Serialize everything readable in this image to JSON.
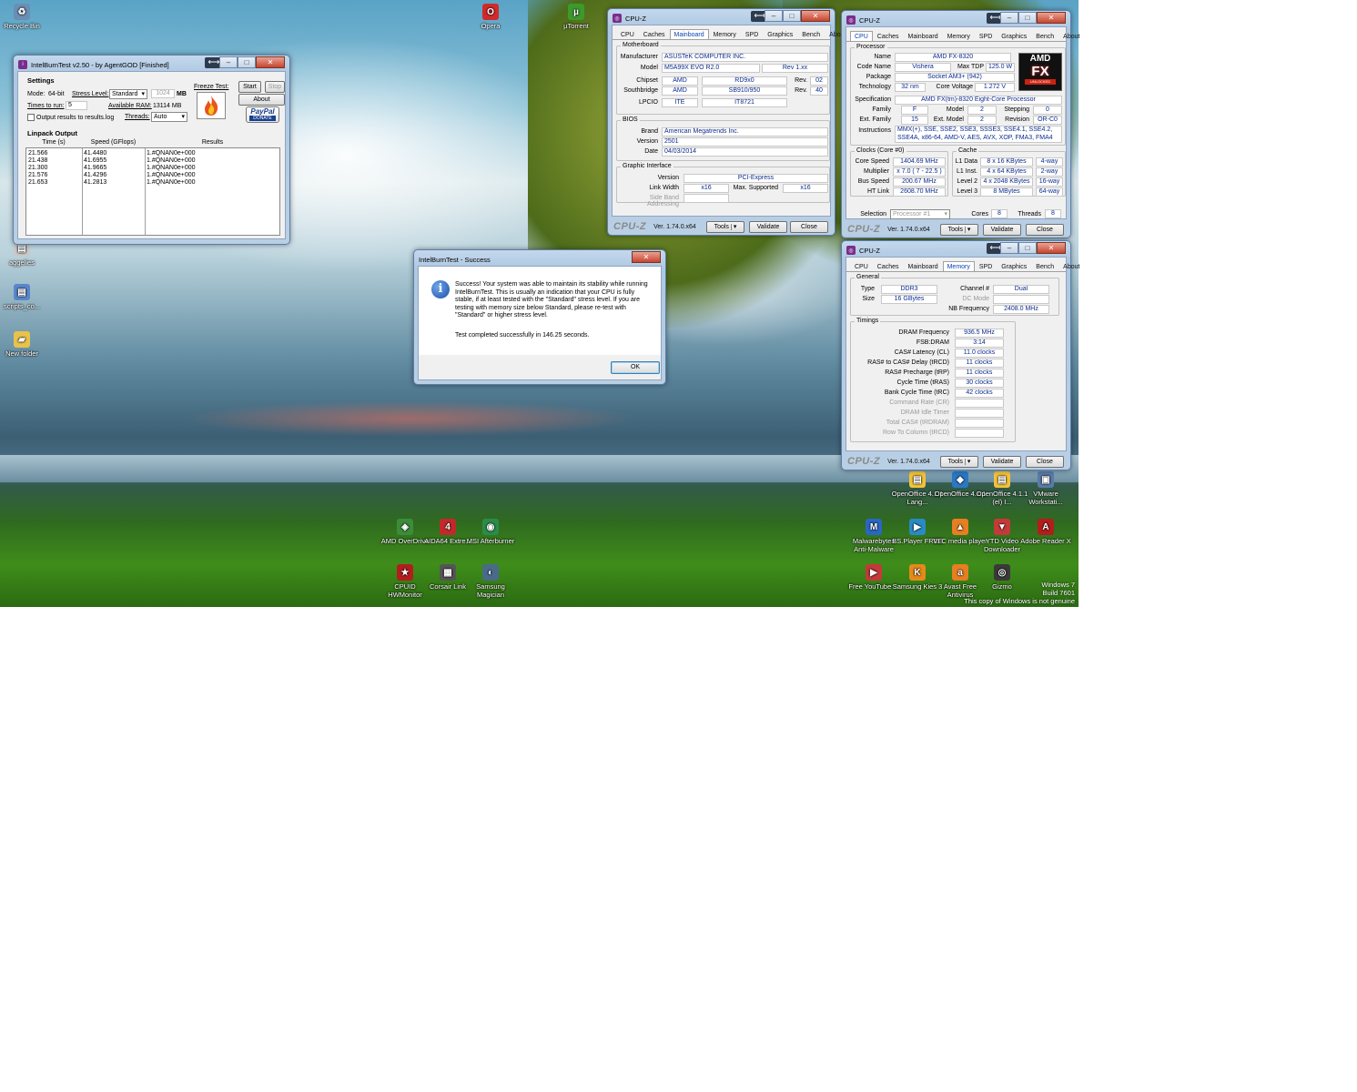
{
  "desktop": {
    "icons": [
      {
        "label": "Recycle Bin",
        "color": "#6a8fb5",
        "glyph": "♻"
      },
      {
        "label": "Opera",
        "color": "#d12a2a",
        "glyph": "O"
      },
      {
        "label": "µTorrent",
        "color": "#3c9a2a",
        "glyph": "µ"
      },
      {
        "label": "aggelies",
        "color": "#c9c9c9",
        "glyph": "▤"
      },
      {
        "label": "scripts_co...",
        "color": "#5a86c9",
        "glyph": "▤"
      },
      {
        "label": "New folder",
        "color": "#e8c24c",
        "glyph": "▰"
      },
      {
        "label": "OpenOffice 4.1.1 Lang...",
        "color": "#f2c23a",
        "glyph": "▤"
      },
      {
        "label": "OpenOffice 4.1.1",
        "color": "#2a78c4",
        "glyph": "◆"
      },
      {
        "label": "OpenOffice 4.1.1 (el) I...",
        "color": "#f2c23a",
        "glyph": "▤"
      },
      {
        "label": "VMware Workstati...",
        "color": "#5a7aa8",
        "glyph": "▣"
      },
      {
        "label": "AMD OverDrive",
        "color": "#3c8c3c",
        "glyph": "◈"
      },
      {
        "label": "AIDA64 Extre...",
        "color": "#c22a2a",
        "glyph": "4"
      },
      {
        "label": "MSI Afterburner",
        "color": "#2a8c4a",
        "glyph": "◉"
      },
      {
        "label": "Malwarebytes Anti-Malware",
        "color": "#2a66c4",
        "glyph": "M"
      },
      {
        "label": "BS.Player FREE",
        "color": "#2a8ac4",
        "glyph": "▶"
      },
      {
        "label": "VLC media player",
        "color": "#e67e22",
        "glyph": "▲"
      },
      {
        "label": "YTD Video Downloader",
        "color": "#c43a3a",
        "glyph": "▼"
      },
      {
        "label": "Adobe Reader X",
        "color": "#b31d1d",
        "glyph": "A"
      },
      {
        "label": "CPUID HWMonitor",
        "color": "#b31d1d",
        "glyph": "★"
      },
      {
        "label": "Corsair Link",
        "color": "#555555",
        "glyph": "▦"
      },
      {
        "label": "Samsung Magician",
        "color": "#4a6a8a",
        "glyph": "◐"
      },
      {
        "label": "Free YouTube ...",
        "color": "#c43a3a",
        "glyph": "▶"
      },
      {
        "label": "Samsung Kies 3",
        "color": "#e58a1a",
        "glyph": "K"
      },
      {
        "label": "Avast Free Antivirus",
        "color": "#e67e22",
        "glyph": "a"
      },
      {
        "label": "Gizmo",
        "color": "#3a3a3a",
        "glyph": "◎"
      }
    ],
    "watermark": [
      "Windows 7",
      "Build 7601",
      "This copy of Windows is not genuine"
    ]
  },
  "ibt": {
    "title": "IntelBurnTest v2.50 - by AgentGOD [Finished]",
    "settings": "Settings",
    "mode_label": "Mode:",
    "mode_value": "64-bit",
    "stress_label": "Stress Level:",
    "stress_value": "Standard",
    "mem_value": "1024",
    "mem_unit": "MB",
    "times_label": "Times to run:",
    "times_value": "5",
    "avail_label": "Available RAM:",
    "avail_value": "13114 MB",
    "output_label": "Output results to results.log",
    "threads_label": "Threads:",
    "threads_value": "Auto",
    "freeze_label": "Freeze Test:",
    "start": "Start",
    "stop": "Stop",
    "about": "About",
    "paypal": "PayPal",
    "donate": "DONATE",
    "linpack": "Linpack Output",
    "col_time": "Time (s)",
    "col_speed": "Speed (GFlops)",
    "col_results": "Results",
    "rows": [
      {
        "time": "21.566",
        "speed": "41.4480",
        "result": "1.#QNAN0e+000"
      },
      {
        "time": "21.438",
        "speed": "41.6955",
        "result": "1.#QNAN0e+000"
      },
      {
        "time": "21.300",
        "speed": "41.9665",
        "result": "1.#QNAN0e+000"
      },
      {
        "time": "21.576",
        "speed": "41.4296",
        "result": "1.#QNAN0e+000"
      },
      {
        "time": "21.653",
        "speed": "41.2813",
        "result": "1.#QNAN0e+000"
      }
    ]
  },
  "dialog": {
    "title": "IntelBurnTest - Success",
    "message": "Success! Your system was able to maintain its stability while running IntelBurnTest. This is usually an indication that your CPU is fully stable, if at least tested with the \"Standard\" stress level. If you are testing with memory size below Standard, please re-test with \"Standard\" or higher stress level.",
    "completed": "Test completed successfully in 146.25 seconds.",
    "ok": "OK"
  },
  "cpuz_common": {
    "title": "CPU-Z",
    "tabs": [
      "CPU",
      "Caches",
      "Mainboard",
      "Memory",
      "SPD",
      "Graphics",
      "Bench",
      "About"
    ],
    "logo": "CPU-Z",
    "version": "Ver. 1.74.0.x64",
    "tools": "Tools",
    "validate": "Validate",
    "close": "Close"
  },
  "mainboard": {
    "motherboard": "Motherboard",
    "manufacturer_l": "Manufacturer",
    "manufacturer": "ASUSTeK COMPUTER INC.",
    "model_l": "Model",
    "model": "M5A99X EVO R2.0",
    "model_rev": "Rev 1.xx",
    "chipset_l": "Chipset",
    "chipset_v": "AMD",
    "chipset_m": "RD9x0",
    "rev_l": "Rev.",
    "chipset_rev": "02",
    "south_l": "Southbridge",
    "south_v": "AMD",
    "south_m": "SB910/950",
    "south_rev": "40",
    "lpcio_l": "LPCIO",
    "lpcio_v": "ITE",
    "lpcio_m": "IT8721",
    "bios": "BIOS",
    "brand_l": "Brand",
    "brand": "American Megatrends Inc.",
    "version_l": "Version",
    "version": "2501",
    "date_l": "Date",
    "date": "04/03/2014",
    "gi": "Graphic Interface",
    "gi_version_l": "Version",
    "gi_version": "PCI-Express",
    "link_l": "Link Width",
    "link": "x16",
    "max_l": "Max. Supported",
    "max": "x16",
    "sba_l": "Side Band Addressing"
  },
  "cpu": {
    "processor": "Processor",
    "name_l": "Name",
    "name": "AMD FX-8320",
    "code_l": "Code Name",
    "code": "Vishera",
    "tdp_l": "Max TDP",
    "tdp": "125.0 W",
    "package_l": "Package",
    "package": "Socket AM3+ (942)",
    "tech_l": "Technology",
    "tech": "32 nm",
    "volt_l": "Core Voltage",
    "volt": "1.272 V",
    "spec_l": "Specification",
    "spec": "AMD FX(tm)-8320 Eight-Core Processor",
    "family_l": "Family",
    "family": "F",
    "model_l": "Model",
    "model": "2",
    "stepping_l": "Stepping",
    "stepping": "0",
    "extfam_l": "Ext. Family",
    "extfam": "15",
    "extmod_l": "Ext. Model",
    "extmod": "2",
    "revision_l": "Revision",
    "revision": "OR-C0",
    "instr_l": "Instructions",
    "instr": "MMX(+), SSE, SSE2, SSE3, SSSE3, SSE4.1, SSE4.2, SSE4A, x86-64, AMD-V, AES, AVX, XOP, FMA3, FMA4",
    "clocks": "Clocks (Core #0)",
    "speed_l": "Core Speed",
    "speed": "1404.69 MHz",
    "mult_l": "Multiplier",
    "mult": "x 7.0 ( 7 - 22.5 )",
    "bus_l": "Bus Speed",
    "bus": "200.67 MHz",
    "ht_l": "HT Link",
    "ht": "2608.70 MHz",
    "cache": "Cache",
    "l1d_l": "L1 Data",
    "l1d": "8 x 16 KBytes",
    "l1d_w": "4-way",
    "l1i_l": "L1 Inst.",
    "l1i": "4 x 64 KBytes",
    "l1i_w": "2-way",
    "l2_l": "Level 2",
    "l2": "4 x 2048 KBytes",
    "l2_w": "16-way",
    "l3_l": "Level 3",
    "l3": "8 MBytes",
    "l3_w": "64-way",
    "selection_l": "Selection",
    "selection": "Processor #1",
    "cores_l": "Cores",
    "cores": "8",
    "threads_l": "Threads",
    "threads": "8",
    "logo_amd": "AMD",
    "logo_fx": "FX",
    "logo_unlocked": "UNLOCKED"
  },
  "memory": {
    "general": "General",
    "type_l": "Type",
    "type": "DDR3",
    "size_l": "Size",
    "size": "16 GBytes",
    "channel_l": "Channel #",
    "channel": "Dual",
    "dc_l": "DC Mode",
    "nb_l": "NB Frequency",
    "nb": "2408.0 MHz",
    "timings": "Timings",
    "rows": [
      {
        "label": "DRAM Frequency",
        "value": "936.5 MHz",
        "dis": false
      },
      {
        "label": "FSB:DRAM",
        "value": "3:14",
        "dis": false
      },
      {
        "label": "CAS# Latency (CL)",
        "value": "11.0 clocks",
        "dis": false
      },
      {
        "label": "RAS# to CAS# Delay (tRCD)",
        "value": "11 clocks",
        "dis": false
      },
      {
        "label": "RAS# Precharge (tRP)",
        "value": "11 clocks",
        "dis": false
      },
      {
        "label": "Cycle Time (tRAS)",
        "value": "30 clocks",
        "dis": false
      },
      {
        "label": "Bank Cycle Time (tRC)",
        "value": "42 clocks",
        "dis": false
      },
      {
        "label": "Command Rate (CR)",
        "value": "",
        "dis": true
      },
      {
        "label": "DRAM Idle Timer",
        "value": "",
        "dis": true
      },
      {
        "label": "Total CAS# (tRDRAM)",
        "value": "",
        "dis": true
      },
      {
        "label": "Row To Column (tRCD)",
        "value": "",
        "dis": true
      }
    ]
  }
}
